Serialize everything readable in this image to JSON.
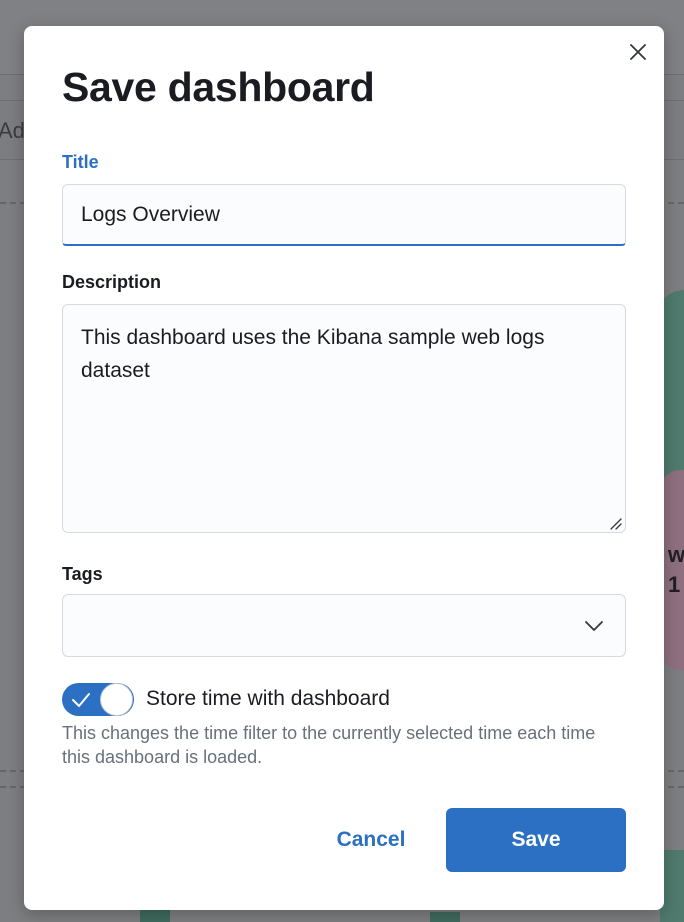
{
  "background": {
    "add_label": "Ad",
    "pie_label": "w\n1"
  },
  "modal": {
    "title": "Save dashboard",
    "close_icon": "close-icon",
    "title_field": {
      "label": "Title",
      "value": "Logs Overview"
    },
    "description_field": {
      "label": "Description",
      "value": "This dashboard uses the Kibana sample web logs dataset"
    },
    "tags_field": {
      "label": "Tags",
      "value": "",
      "icon": "chevron-down-icon"
    },
    "store_time": {
      "label": "Store time with dashboard",
      "checked": true,
      "help": "This changes the time filter to the currently selected time each time this dashboard is loaded."
    },
    "buttons": {
      "cancel": "Cancel",
      "save": "Save"
    }
  },
  "colors": {
    "accent": "#2b70c2",
    "text": "#1a1c21",
    "subdued": "#69707d",
    "overlay": "#7d7e81"
  }
}
